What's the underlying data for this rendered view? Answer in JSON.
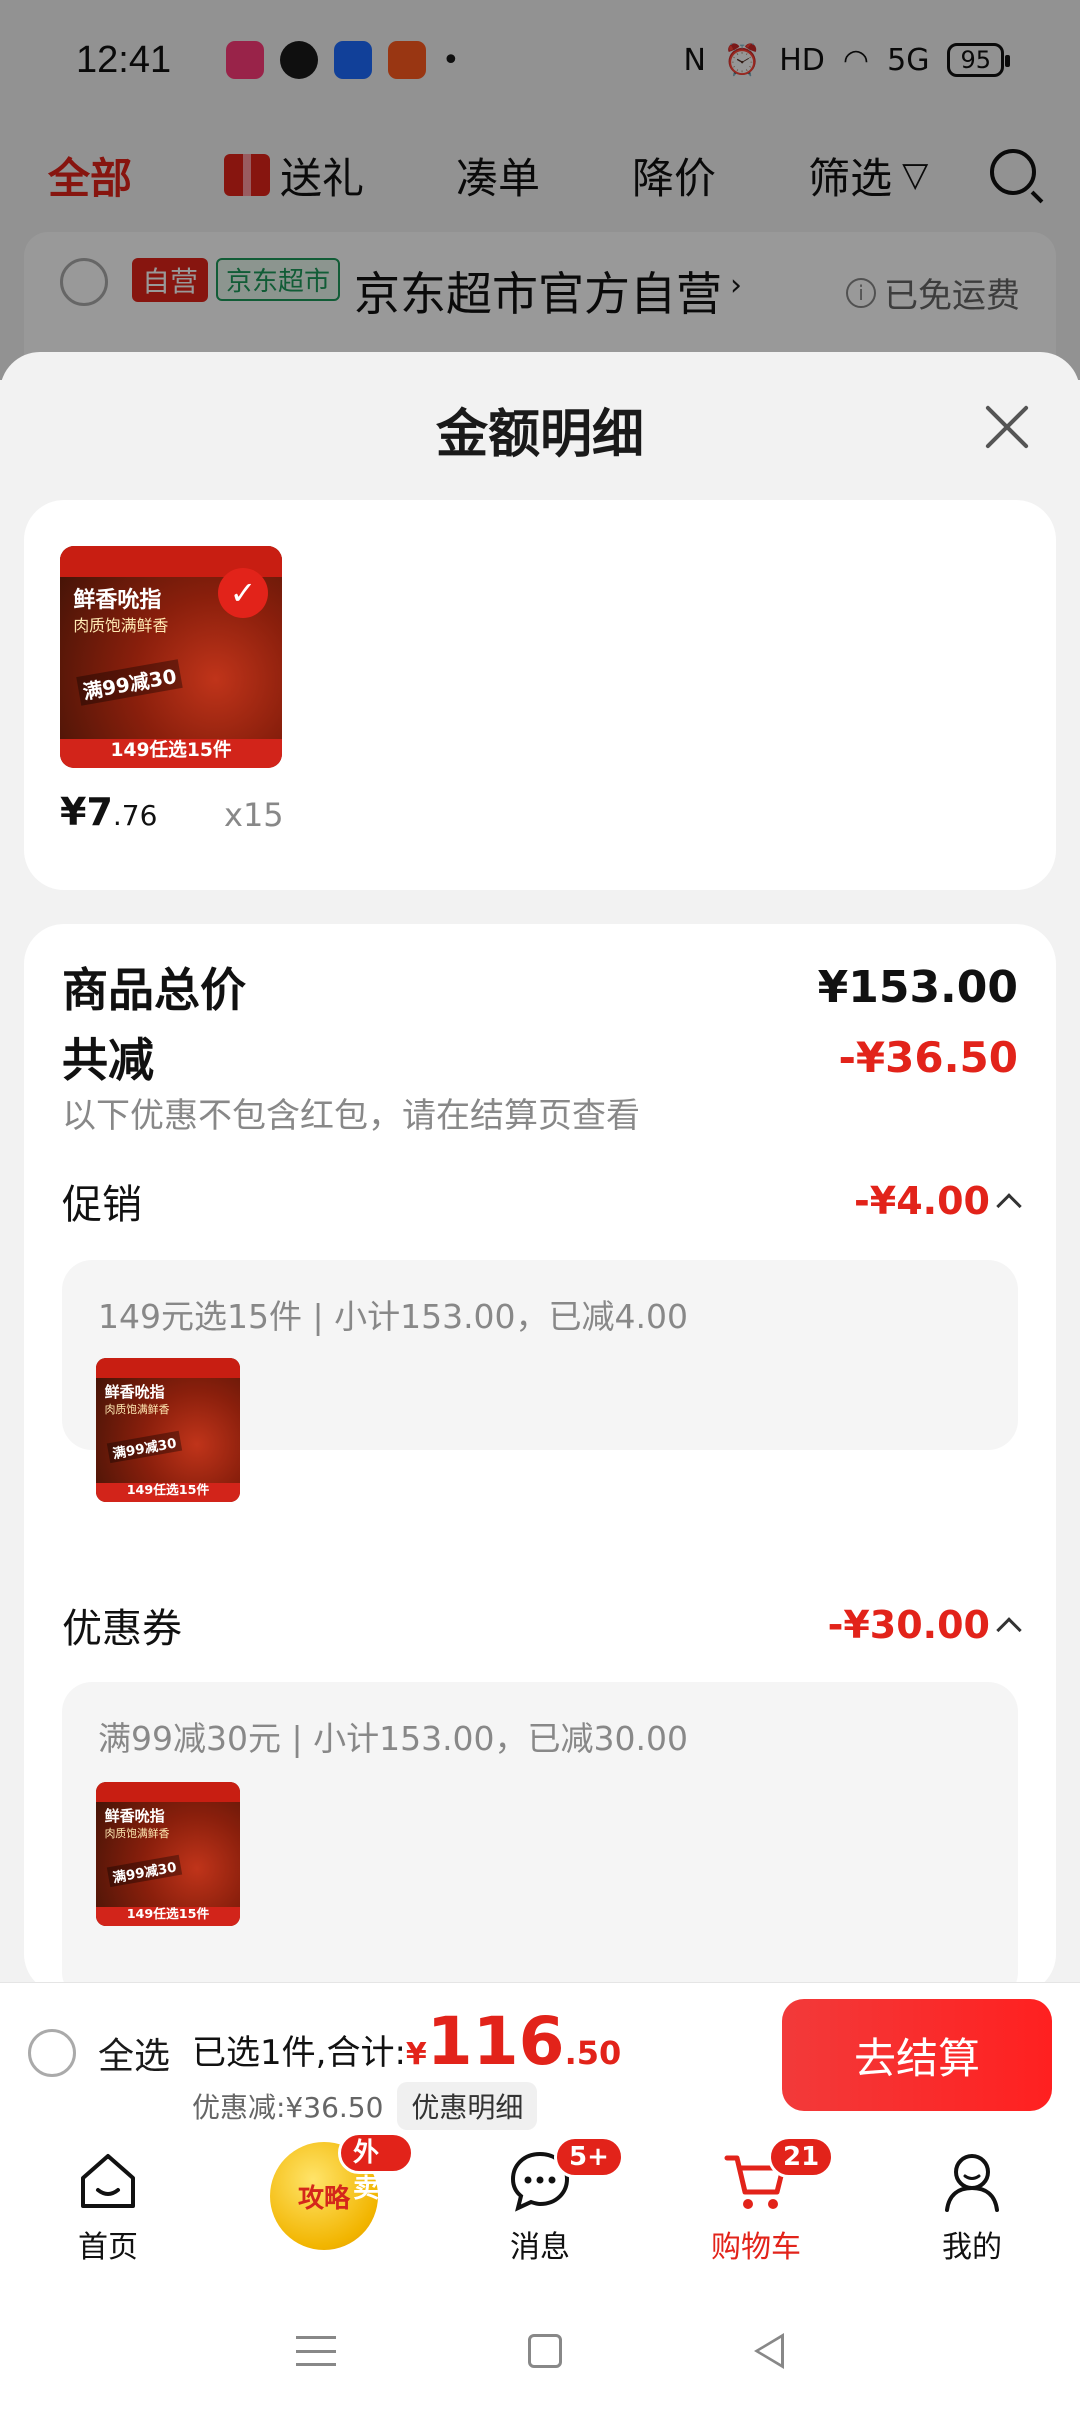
{
  "status_bar": {
    "time": "12:41",
    "battery": "95",
    "network": "5G"
  },
  "cart_header": {
    "tabs": [
      {
        "label": "全部",
        "active": true
      },
      {
        "label": "送礼",
        "active": false
      },
      {
        "label": "凑单",
        "active": false
      },
      {
        "label": "降价",
        "active": false
      },
      {
        "label": "筛选",
        "active": false
      }
    ]
  },
  "store": {
    "tag_self": "自营",
    "tag_super": "京东超市",
    "name": "京东超市官方自营",
    "shipping": "已免运费"
  },
  "sheet": {
    "title": "金额明细",
    "product": {
      "badge_line1": "鲜香吮指",
      "badge_line2": "肉质饱满鲜香",
      "coupon_text": "满99减30",
      "bottom_text": "149任选15件",
      "price_int": "¥7",
      "price_dec": ".76",
      "qty": "x15"
    },
    "detail": {
      "total_label": "商品总价",
      "total_value": "¥153.00",
      "discount_label": "共减",
      "discount_value": "-¥36.50",
      "discount_note": "以下优惠不包含红包，请在结算页查看",
      "promo_label": "促销",
      "promo_value": "-¥4.00",
      "promo_desc": "149元选15件 | 小计153.00，已减4.00",
      "coupon_label": "优惠券",
      "coupon_value": "-¥30.00",
      "coupon_desc": "满99减30元 | 小计153.00，已减30.00"
    }
  },
  "checkout": {
    "select_all": "全选",
    "selected_text": "已选1件,合计:",
    "total_currency": "¥",
    "total_int": "116",
    "total_dec": ".50",
    "saved_text": "优惠减:¥36.50",
    "detail_chip": "优惠明细",
    "button": "去结算"
  },
  "tabbar": {
    "items": [
      {
        "label": "首页",
        "active": false
      },
      {
        "label": "攻略",
        "badge": "外卖",
        "active": false
      },
      {
        "label": "消息",
        "badge": "5+",
        "active": false
      },
      {
        "label": "购物车",
        "badge": "21",
        "active": true
      },
      {
        "label": "我的",
        "active": false
      }
    ]
  }
}
